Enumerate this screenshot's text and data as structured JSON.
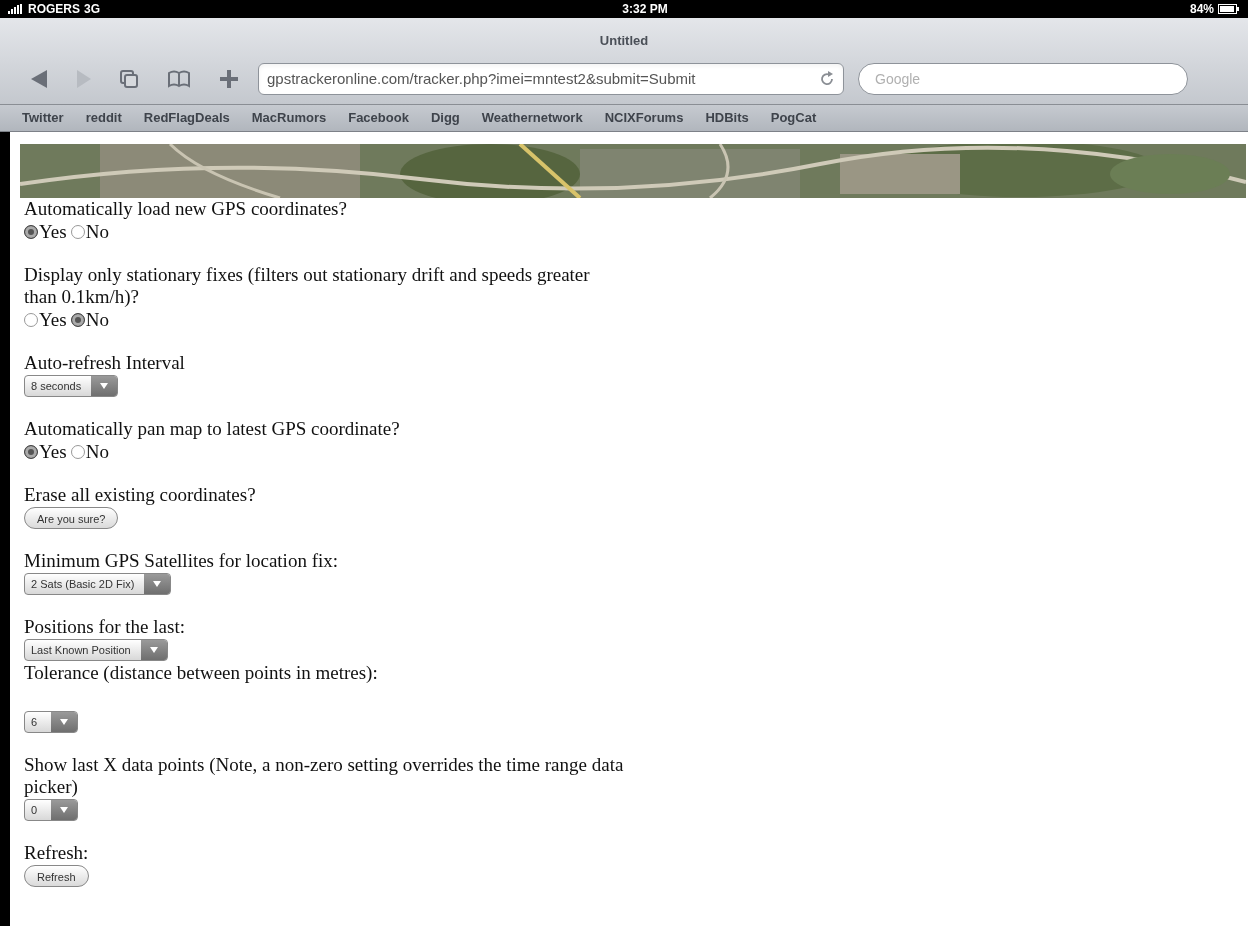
{
  "status_bar": {
    "carrier": "ROGERS",
    "network": "3G",
    "time": "3:32 PM",
    "battery": "84%"
  },
  "window": {
    "title": "Untitled"
  },
  "toolbar": {
    "back_enabled": true,
    "forward_enabled": false,
    "url": "gpstrackeronline.com/tracker.php?imei=mntest2&submit=Submit",
    "search_placeholder": "Google"
  },
  "bookmarks": [
    "Twitter",
    "reddit",
    "RedFlagDeals",
    "MacRumors",
    "Facebook",
    "Digg",
    "Weathernetwork",
    "NCIXForums",
    "HDBits",
    "PogCat"
  ],
  "sections": [
    {
      "fields": [
        {
          "label": "Automatically load new GPS coordinates?",
          "kind": "radio",
          "options": [
            {
              "label": "Yes",
              "selected": true
            },
            {
              "label": "No",
              "selected": false
            }
          ]
        }
      ]
    },
    {
      "fields": [
        {
          "label": "Display only stationary fixes (filters out stationary drift and speeds greater than 0.1km/h)?",
          "kind": "radio",
          "options": [
            {
              "label": "Yes",
              "selected": false
            },
            {
              "label": "No",
              "selected": true
            }
          ]
        }
      ]
    },
    {
      "fields": [
        {
          "label": "Auto-refresh Interval",
          "kind": "select",
          "value": "8 seconds"
        }
      ]
    },
    {
      "fields": [
        {
          "label": "Automatically pan map to latest GPS coordinate?",
          "kind": "radio",
          "options": [
            {
              "label": "Yes",
              "selected": true
            },
            {
              "label": "No",
              "selected": false
            }
          ]
        }
      ]
    },
    {
      "fields": [
        {
          "label": "Erase all existing coordinates?",
          "kind": "button",
          "value": "Are you sure?"
        }
      ]
    },
    {
      "fields": [
        {
          "label": "Minimum GPS Satellites for location fix:",
          "kind": "select",
          "value": "2 Sats (Basic 2D Fix)"
        }
      ]
    },
    {
      "fields": [
        {
          "label": "Positions for the last:",
          "kind": "select",
          "value": "Last Known Position"
        },
        {
          "label": "Tolerance (distance between points in metres):",
          "kind": "select",
          "value": "6",
          "spaced": true
        }
      ]
    },
    {
      "fields": [
        {
          "label": "Show last X data points (Note, a non-zero setting overrides the time range data picker)",
          "kind": "select",
          "value": "0"
        }
      ]
    },
    {
      "fields": [
        {
          "label": "Refresh:",
          "kind": "button",
          "value": "Refresh"
        }
      ]
    }
  ]
}
